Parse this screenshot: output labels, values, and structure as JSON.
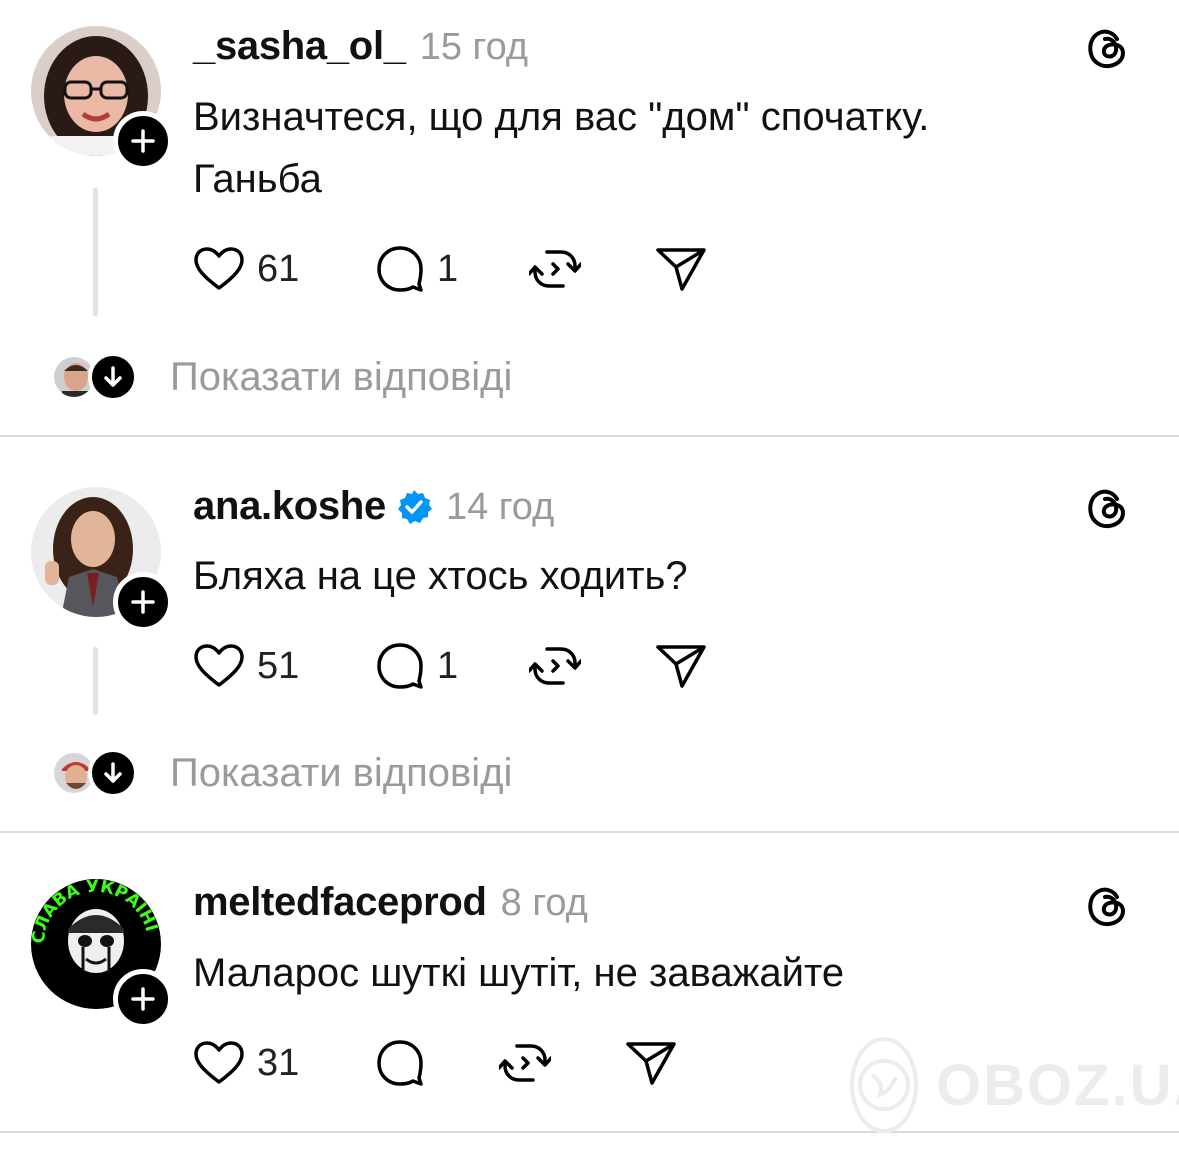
{
  "posts": [
    {
      "username": "_sasha_ol_",
      "time": "15 год",
      "verified": false,
      "text_lines": [
        "Визначтеся, що для вас \"дом\" спочатку.",
        "Ганьба"
      ],
      "likes": "61",
      "comments": "1",
      "show_replies": "Показати відповіді"
    },
    {
      "username": "ana.koshe",
      "time": "14 год",
      "verified": true,
      "text_lines": [
        "Бляха на це хтось ходить?"
      ],
      "likes": "51",
      "comments": "1",
      "show_replies": "Показати відповіді"
    },
    {
      "username": "meltedfaceprod",
      "time": "8 год",
      "verified": false,
      "text_lines": [
        "Маларос шуткі шутіт, не заважайте"
      ],
      "likes": "31",
      "comments": "",
      "show_replies": ""
    }
  ],
  "icons": {
    "like": "heart-icon",
    "comment": "comment-bubble-icon",
    "repost": "repost-icon",
    "share": "send-icon",
    "follow": "plus-icon",
    "expand": "arrow-down-icon",
    "brand": "threads-logo-icon",
    "verified": "verified-badge-icon"
  },
  "avatar3_ring_text": "СЛАВА УКРАЇНІ",
  "watermark": {
    "text": "OBOZ.UA"
  },
  "colors": {
    "text": "#111111",
    "muted": "#9a9a9a",
    "verified": "#0095f6",
    "separator": "#dcdcdc",
    "avatar3_ring": "#39ff14"
  }
}
